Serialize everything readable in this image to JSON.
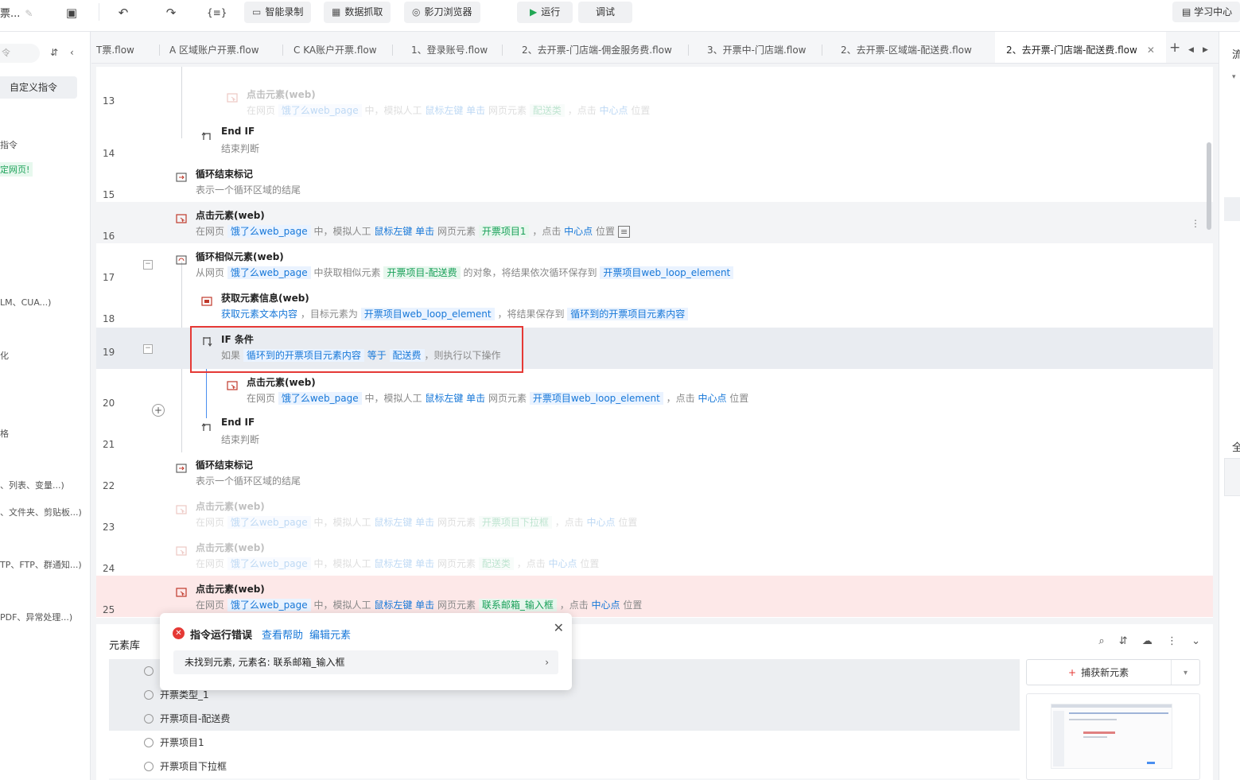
{
  "toolbar": {
    "title": "票...",
    "smart_record": "智能录制",
    "data_scrape": "数据抓取",
    "browser": "影刀浏览器",
    "run": "运行",
    "debug": "调试",
    "learning_center": "学习中心"
  },
  "sidebar": {
    "search_placeholder": "令",
    "custom_command": "自定义指令",
    "texts": [
      "指令",
      "LM、CUA...)",
      "化",
      "格",
      "、列表、变量...)",
      "、文件夹、剪贴板...)",
      "TP、FTP、群通知...)",
      "PDF、异常处理...)"
    ],
    "green_text": "定网页!"
  },
  "tabs": [
    "T票.flow",
    "A 区域账户开票.flow",
    "C KA账户开票.flow",
    "1、登录账号.flow",
    "2、去开票-门店端-佣金服务费.flow",
    "3、开票中-门店端.flow",
    "2、去开票-区域端-配送费.flow",
    "2、去开票-门店端-配送费.flow"
  ],
  "editor": {
    "rows": [
      {
        "num": "13",
        "title": "点击元素(web)",
        "d": [
          "在网页",
          "饿了么web_page",
          "中，模拟人工",
          "鼠标左键",
          "单击",
          "网页元素",
          "配送类",
          "，点击",
          "中心点",
          "位置"
        ]
      },
      {
        "num": "14",
        "title": "End IF",
        "desc": "结束判断"
      },
      {
        "num": "15",
        "title": "循环结束标记",
        "desc": "表示一个循环区域的结尾"
      },
      {
        "num": "16",
        "title": "点击元素(web)",
        "d": [
          "在网页",
          "饿了么web_page",
          "中，模拟人工",
          "鼠标左键",
          "单击",
          "网页元素",
          "开票项目1",
          "，点击",
          "中心点",
          "位置"
        ]
      },
      {
        "num": "17",
        "title": "循环相似元素(web)",
        "d": [
          "从网页",
          "饿了么web_page",
          "中获取相似元素",
          "开票项目-配送费",
          "的对象，将结果依次循环保存到",
          "开票项目web_loop_element"
        ]
      },
      {
        "num": "18",
        "title": "获取元素信息(web)",
        "d": [
          "获取元素文本内容",
          "，目标元素为",
          "开票项目web_loop_element",
          "，将结果保存到",
          "循环到的开票项目元素内容"
        ]
      },
      {
        "num": "19",
        "title": "IF 条件",
        "d": [
          "如果",
          "循环到的开票项目元素内容",
          "等于",
          "配送费",
          "，则执行以下操作"
        ]
      },
      {
        "num": "20",
        "title": "点击元素(web)",
        "d": [
          "在网页",
          "饿了么web_page",
          "中，模拟人工",
          "鼠标左键",
          "单击",
          "网页元素",
          "开票项目web_loop_element",
          "，点击",
          "中心点",
          "位置"
        ]
      },
      {
        "num": "21",
        "title": "End IF",
        "desc": "结束判断"
      },
      {
        "num": "22",
        "title": "循环结束标记",
        "desc": "表示一个循环区域的结尾"
      },
      {
        "num": "23",
        "title": "点击元素(web)",
        "d": [
          "在网页",
          "饿了么web_page",
          "中，模拟人工",
          "鼠标左键",
          "单击",
          "网页元素",
          "开票项目下拉框",
          "，点击",
          "中心点",
          "位置"
        ]
      },
      {
        "num": "24",
        "title": "点击元素(web)",
        "d": [
          "在网页",
          "饿了么web_page",
          "中，模拟人工",
          "鼠标左键",
          "单击",
          "网页元素",
          "配送类",
          "，点击",
          "中心点",
          "位置"
        ]
      },
      {
        "num": "25",
        "title": "点击元素(web)",
        "d": [
          "在网页",
          "饿了么web_page",
          "中，模拟人工",
          "鼠标左键",
          "单击",
          "网页元素",
          "联系邮箱_输入框",
          "，点击",
          "中心点",
          "位置"
        ]
      }
    ]
  },
  "library": {
    "title": "元素库",
    "items": [
      "开票类型_1",
      "开票项目-配送费",
      "开票项目1",
      "开票项目下拉框"
    ],
    "capture_label": "捕获新元素"
  },
  "popup": {
    "title": "指令运行错误",
    "help": "查看帮助",
    "edit": "编辑元素",
    "message": "未找到元素, 元素名: 联系邮箱_输入框"
  },
  "right": {
    "t1": "流",
    "t2": "全"
  },
  "colors": {
    "variable_blue": "#1677d8",
    "element_green": "#18a058",
    "error_red": "#e53935",
    "selected_row": "#e9ecf1",
    "error_row": "#fde8e8"
  }
}
